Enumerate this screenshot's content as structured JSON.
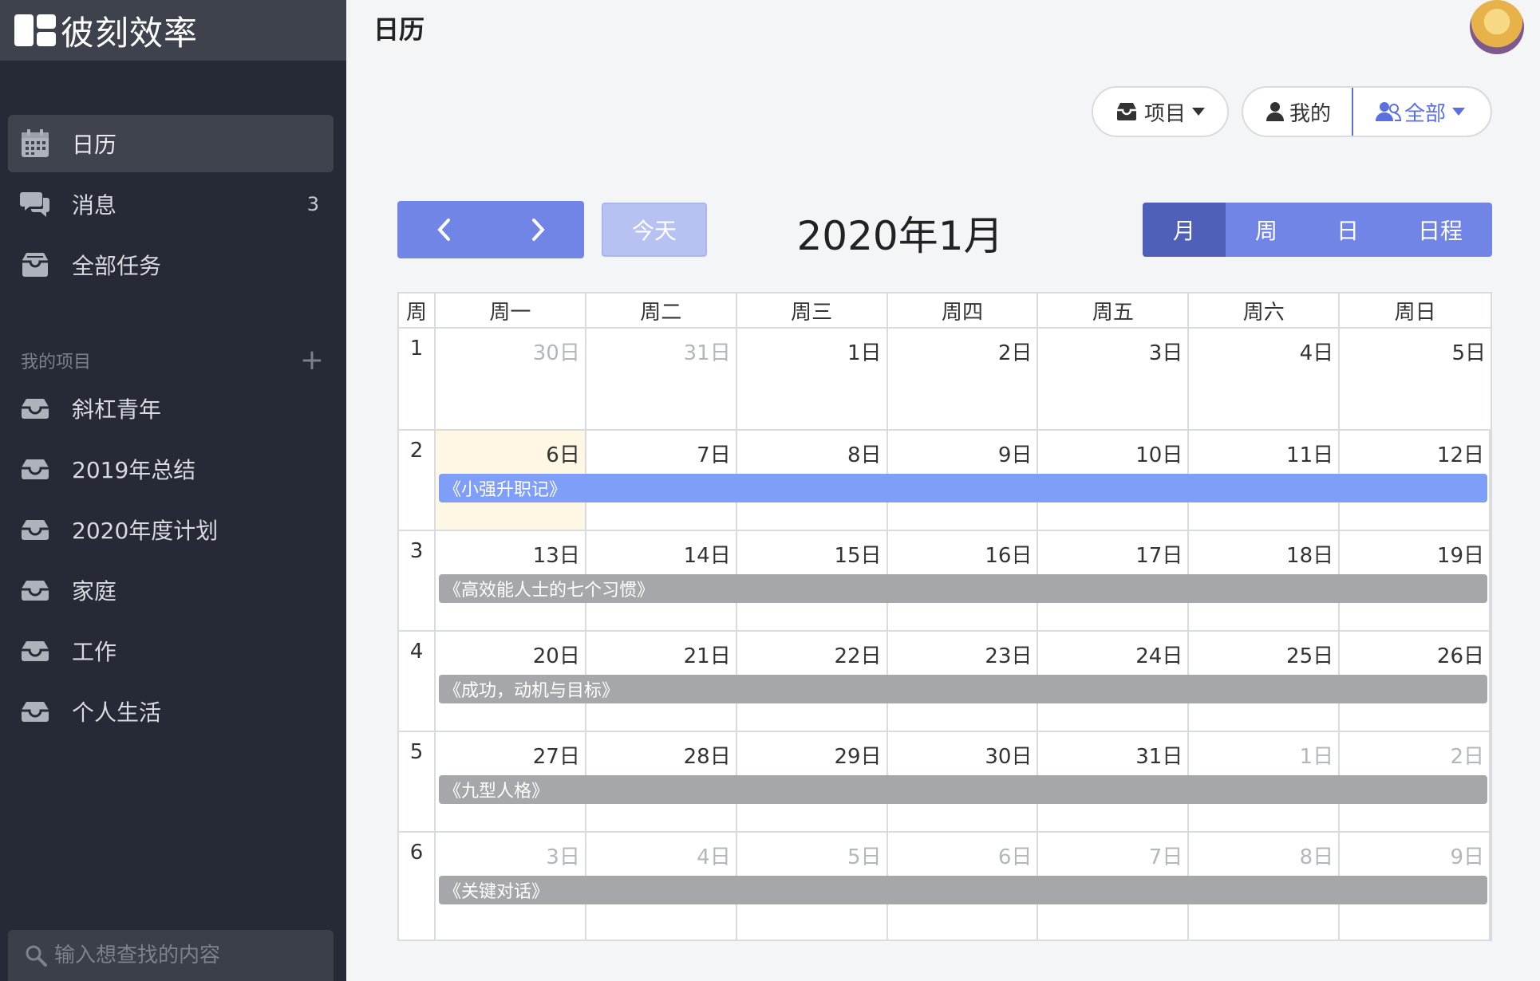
{
  "brand": {
    "name": "彼刻效率"
  },
  "sidebar": {
    "nav": [
      {
        "label": "日历",
        "icon": "calendar-icon",
        "active": true
      },
      {
        "label": "消息",
        "icon": "chat-icon",
        "count": "3"
      },
      {
        "label": "全部任务",
        "icon": "inbox-icon"
      }
    ],
    "projects_title": "我的项目",
    "projects": [
      {
        "label": "斜杠青年"
      },
      {
        "label": "2019年总结"
      },
      {
        "label": "2020年度计划"
      },
      {
        "label": "家庭"
      },
      {
        "label": "工作"
      },
      {
        "label": "个人生活"
      }
    ],
    "search_placeholder": "输入想查找的内容"
  },
  "header": {
    "title": "日历"
  },
  "filters": {
    "project": "项目",
    "mine": "我的",
    "all": "全部"
  },
  "toolbar": {
    "today": "今天",
    "month_title": "2020年1月",
    "views": [
      "月",
      "周",
      "日",
      "日程"
    ],
    "selected_view": "月"
  },
  "calendar": {
    "headers": [
      "周",
      "周一",
      "周二",
      "周三",
      "周四",
      "周五",
      "周六",
      "周日"
    ],
    "weeks": [
      {
        "num": "1",
        "days": [
          "30日",
          "31日",
          "1日",
          "2日",
          "3日",
          "4日",
          "5日"
        ]
      },
      {
        "num": "2",
        "days": [
          "6日",
          "7日",
          "8日",
          "9日",
          "10日",
          "11日",
          "12日"
        ],
        "event": "《小强升职记》",
        "event_color": "#7f9ef7"
      },
      {
        "num": "3",
        "days": [
          "13日",
          "14日",
          "15日",
          "16日",
          "17日",
          "18日",
          "19日"
        ],
        "event": "《高效能人士的七个习惯》",
        "event_color": "#a5a7ab"
      },
      {
        "num": "4",
        "days": [
          "20日",
          "21日",
          "22日",
          "23日",
          "24日",
          "25日",
          "26日"
        ],
        "event": "《成功，动机与目标》",
        "event_color": "#a5a7ab"
      },
      {
        "num": "5",
        "days": [
          "27日",
          "28日",
          "29日",
          "30日",
          "31日",
          "1日",
          "2日"
        ],
        "event": "《九型人格》",
        "event_color": "#a5a7ab"
      },
      {
        "num": "6",
        "days": [
          "3日",
          "4日",
          "5日",
          "6日",
          "7日",
          "8日",
          "9日"
        ],
        "event": "《关键对话》",
        "event_color": "#a5a7ab"
      }
    ]
  },
  "colors": {
    "accent": "#7185e6",
    "accent_dark": "#4f60b8",
    "sidebar_bg": "#252a36",
    "today_bg": "#fdf7e4"
  }
}
